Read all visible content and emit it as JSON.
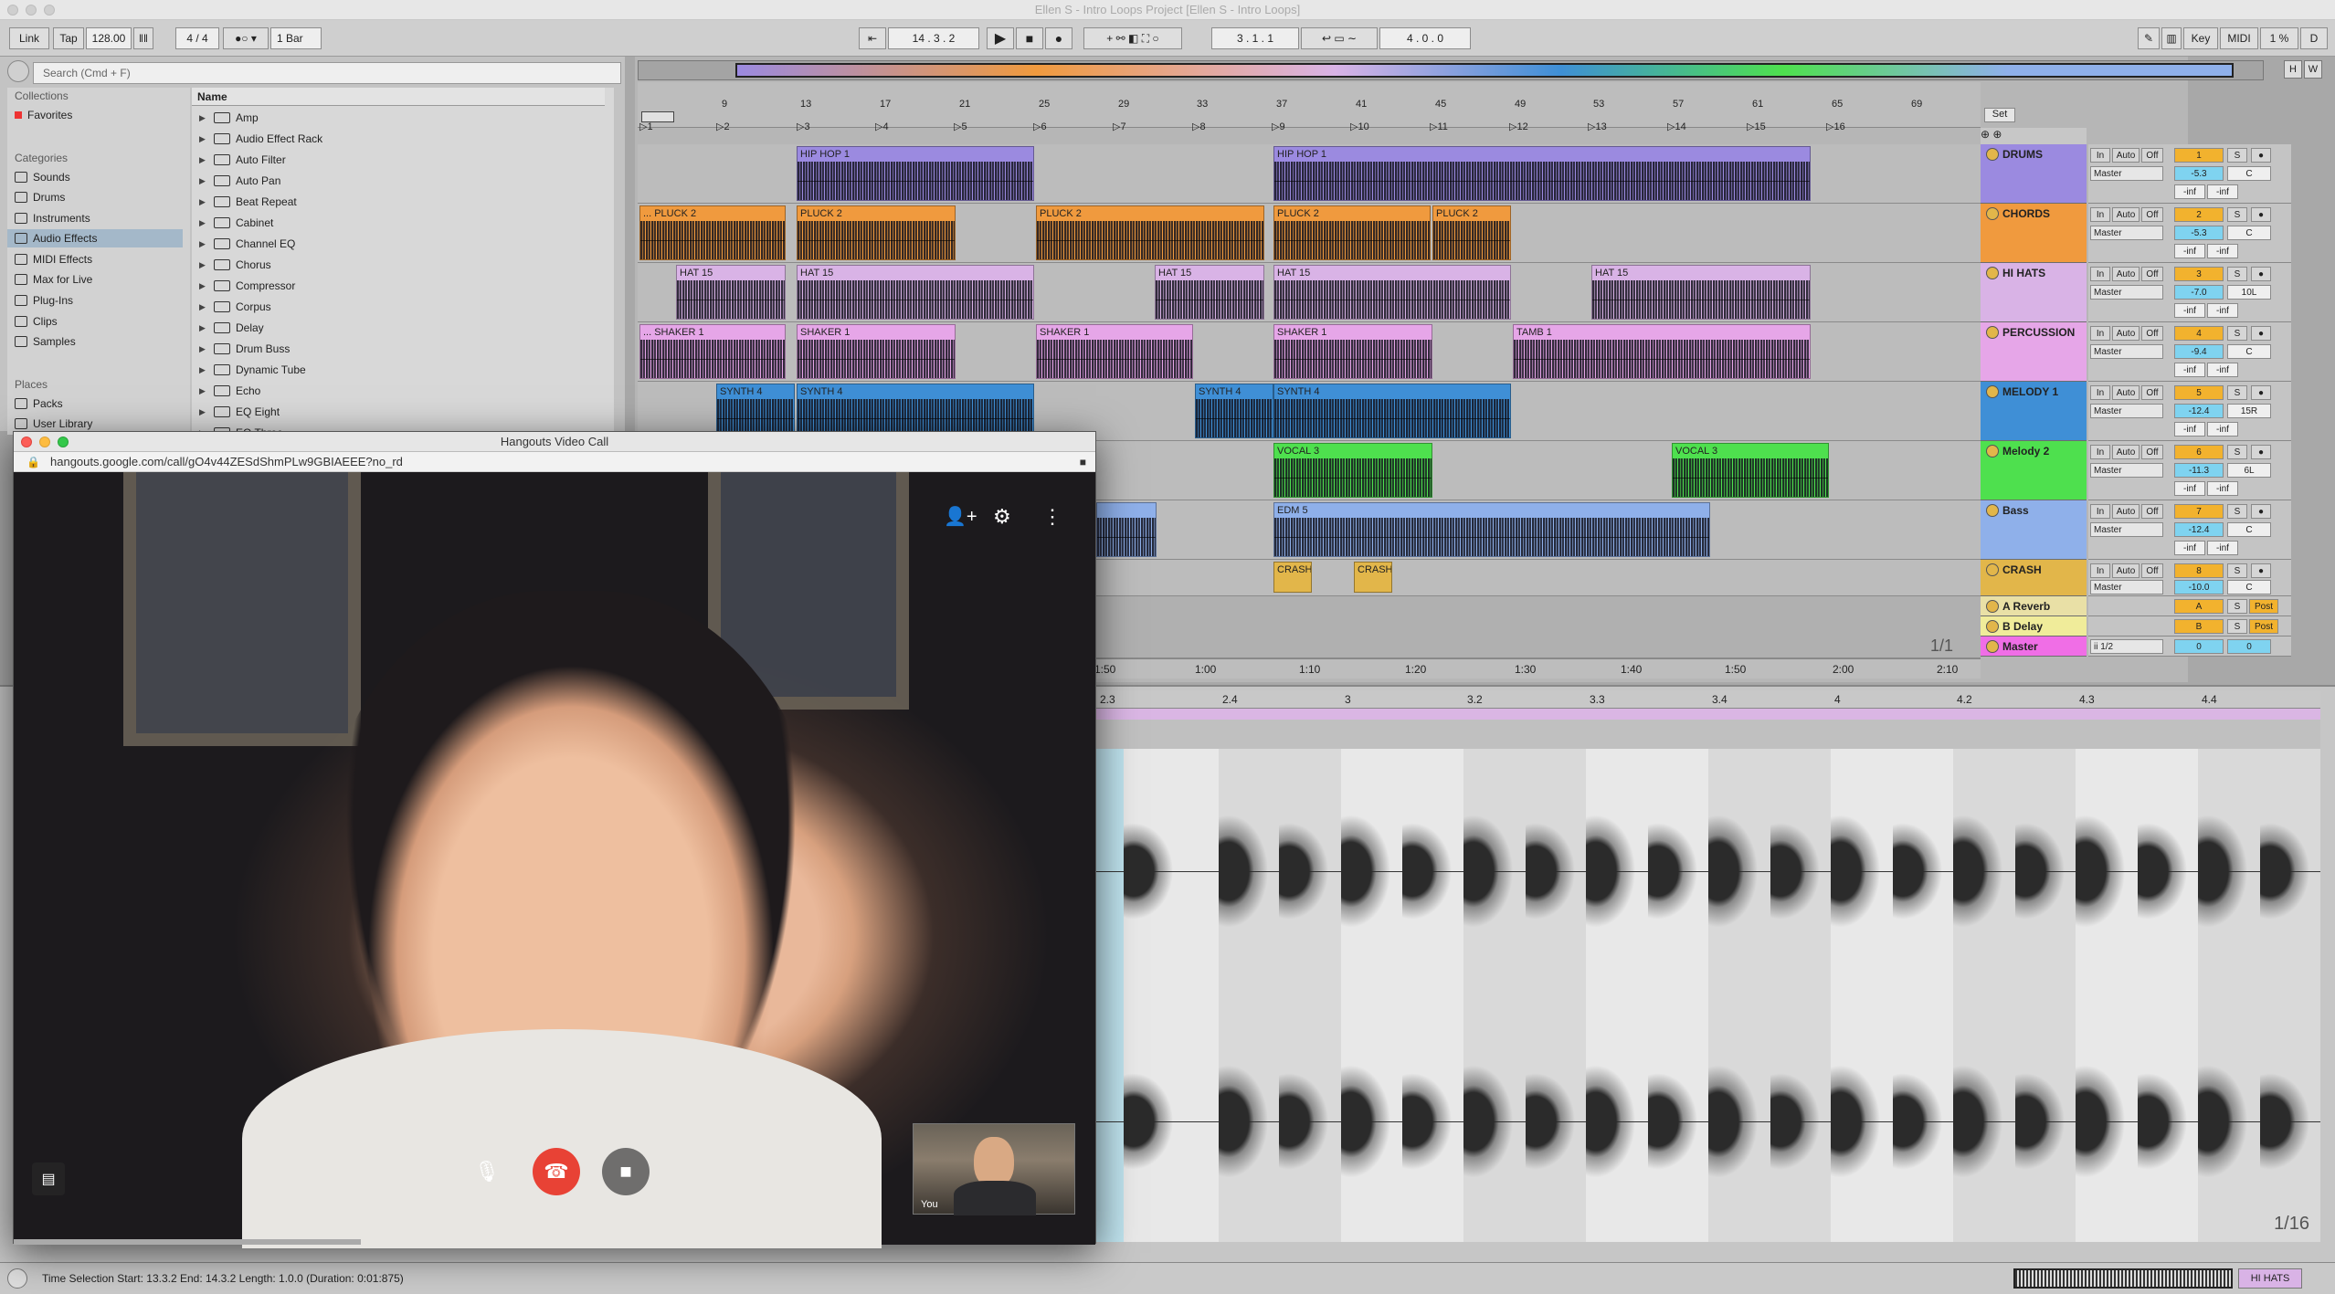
{
  "window": {
    "title": "Ellen S - Intro Loops Project  [Ellen S - Intro Loops]"
  },
  "control": {
    "link": "Link",
    "tap": "Tap",
    "tempo": "128.00",
    "meter": "4 / 4",
    "quant": "1 Bar",
    "position": "14 .  3 .  2",
    "loop_start": "3 .  1 .  1",
    "loop_len": "4 .  0 .  0",
    "key": "Key",
    "midi": "MIDI",
    "cpu": "1 %",
    "d": "D"
  },
  "browser": {
    "search_placeholder": "Search (Cmd + F)",
    "collections_label": "Collections",
    "favorites": "Favorites",
    "categories_label": "Categories",
    "categories": [
      "Sounds",
      "Drums",
      "Instruments",
      "Audio Effects",
      "MIDI Effects",
      "Max for Live",
      "Plug-Ins",
      "Clips",
      "Samples"
    ],
    "places_label": "Places",
    "places": [
      "Packs",
      "User Library"
    ],
    "name_header": "Name",
    "items": [
      "Amp",
      "Audio Effect Rack",
      "Auto Filter",
      "Auto Pan",
      "Beat Repeat",
      "Cabinet",
      "Channel EQ",
      "Chorus",
      "Compressor",
      "Corpus",
      "Delay",
      "Drum Buss",
      "Dynamic Tube",
      "Echo",
      "EQ Eight",
      "EQ Three"
    ]
  },
  "ruler": {
    "markers": [
      "9",
      "13",
      "17",
      "21",
      "25",
      "29",
      "33",
      "37",
      "41",
      "45",
      "49",
      "53",
      "57",
      "61",
      "65",
      "69"
    ],
    "scenes": [
      "1",
      "2",
      "3",
      "4",
      "5",
      "6",
      "7",
      "8",
      "9",
      "10",
      "11",
      "12",
      "13",
      "14",
      "15",
      "16"
    ],
    "set": "Set"
  },
  "tracks": [
    {
      "name": "DRUMS",
      "num": "1",
      "vol": "-5.3",
      "pan": "C",
      "color": "#9b8ae0"
    },
    {
      "name": "CHORDS",
      "num": "2",
      "vol": "-5.3",
      "pan": "C",
      "color": "#f09a3e"
    },
    {
      "name": "HI HATS",
      "num": "3",
      "vol": "-7.0",
      "pan": "10L",
      "color": "#d9b3e6"
    },
    {
      "name": "PERCUSSION",
      "num": "4",
      "vol": "-9.4",
      "pan": "C",
      "color": "#e6a6e8"
    },
    {
      "name": "MELODY 1",
      "num": "5",
      "vol": "-12.4",
      "pan": "15R",
      "color": "#3f8fd6"
    },
    {
      "name": "Melody 2",
      "num": "6",
      "vol": "-11.3",
      "pan": "6L",
      "color": "#4ee04e"
    },
    {
      "name": "Bass",
      "num": "7",
      "vol": "-12.4",
      "pan": "C",
      "color": "#8fb0ea"
    },
    {
      "name": "CRASH",
      "num": "8",
      "vol": "-10.0",
      "pan": "C",
      "color": "#e2b64a"
    }
  ],
  "returns": [
    {
      "name": "A Reverb",
      "num": "A",
      "post": "Post"
    },
    {
      "name": "B Delay",
      "num": "B",
      "post": "Post"
    },
    {
      "name": "Master",
      "num": "0",
      "io": "ii 1/2",
      "vol": "0"
    }
  ],
  "mixer": {
    "in": "In",
    "auto": "Auto",
    "off": "Off",
    "route": "Master",
    "inf": "-inf",
    "s": "S"
  },
  "clips": {
    "hiphop": "HIP HOP 1",
    "pluck": "PLUCK 2",
    "pluck_cut": "... PLUCK 2",
    "hat": "HAT 15",
    "shaker": "SHAKER 1",
    "shaker_cut": "... SHAKER 1",
    "tamb": "TAMB 1",
    "synth": "SYNTH 4",
    "vocal": "VOCAL 3",
    "edm": "EDM 5",
    "crash": "CRASH"
  },
  "timeline": {
    "page": "1/1",
    "times": [
      "1:50",
      "1:00",
      "1:10",
      "1:20",
      "1:30",
      "1:40",
      "1:50",
      "2:00",
      "2:10"
    ]
  },
  "detail": {
    "ruler": [
      "2.3",
      "2.4",
      "3",
      "3.2",
      "3.3",
      "3.4",
      "4",
      "4.2",
      "4.3",
      "4.4"
    ],
    "zoom": "1/16"
  },
  "status": {
    "left": "Time Selection   Start: 13.3.2   End: 14.3.2   Length: 1.0.0  (Duration: 0:01:875)",
    "right": "HI HATS"
  },
  "hangouts": {
    "title": "Hangouts Video Call",
    "url": "hangouts.google.com/call/gO4v44ZESdShmPLw9GBIAEEE?no_rd",
    "you": "You"
  }
}
